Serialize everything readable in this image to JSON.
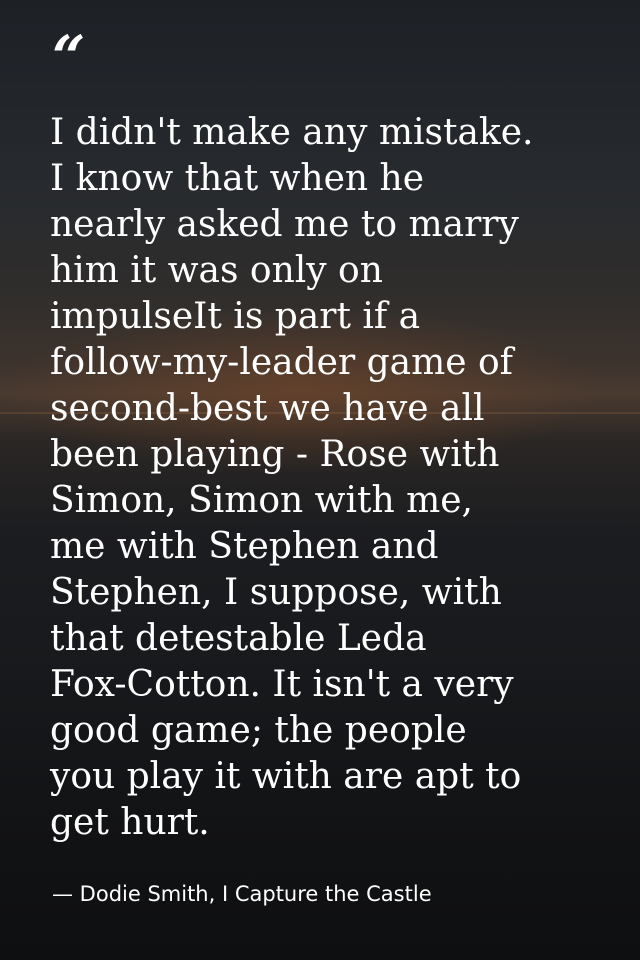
{
  "quote": {
    "mark": "“",
    "text": "I didn't make any mistake.\nI know that when he\nnearly asked me to marry\nhim it was only on\nimpulseIt is part if a\nfollow-my-leader game of\nsecond-best we have all\nbeen playing - Rose with\nSimon, Simon with me,\nme with Stephen and\nStephen, I suppose, with\nthat detestable Leda\nFox-Cotton. It isn't a very\ngood game; the people\nyou play it with are apt to\nget hurt.",
    "attribution": "— Dodie Smith, I Capture the Castle"
  }
}
